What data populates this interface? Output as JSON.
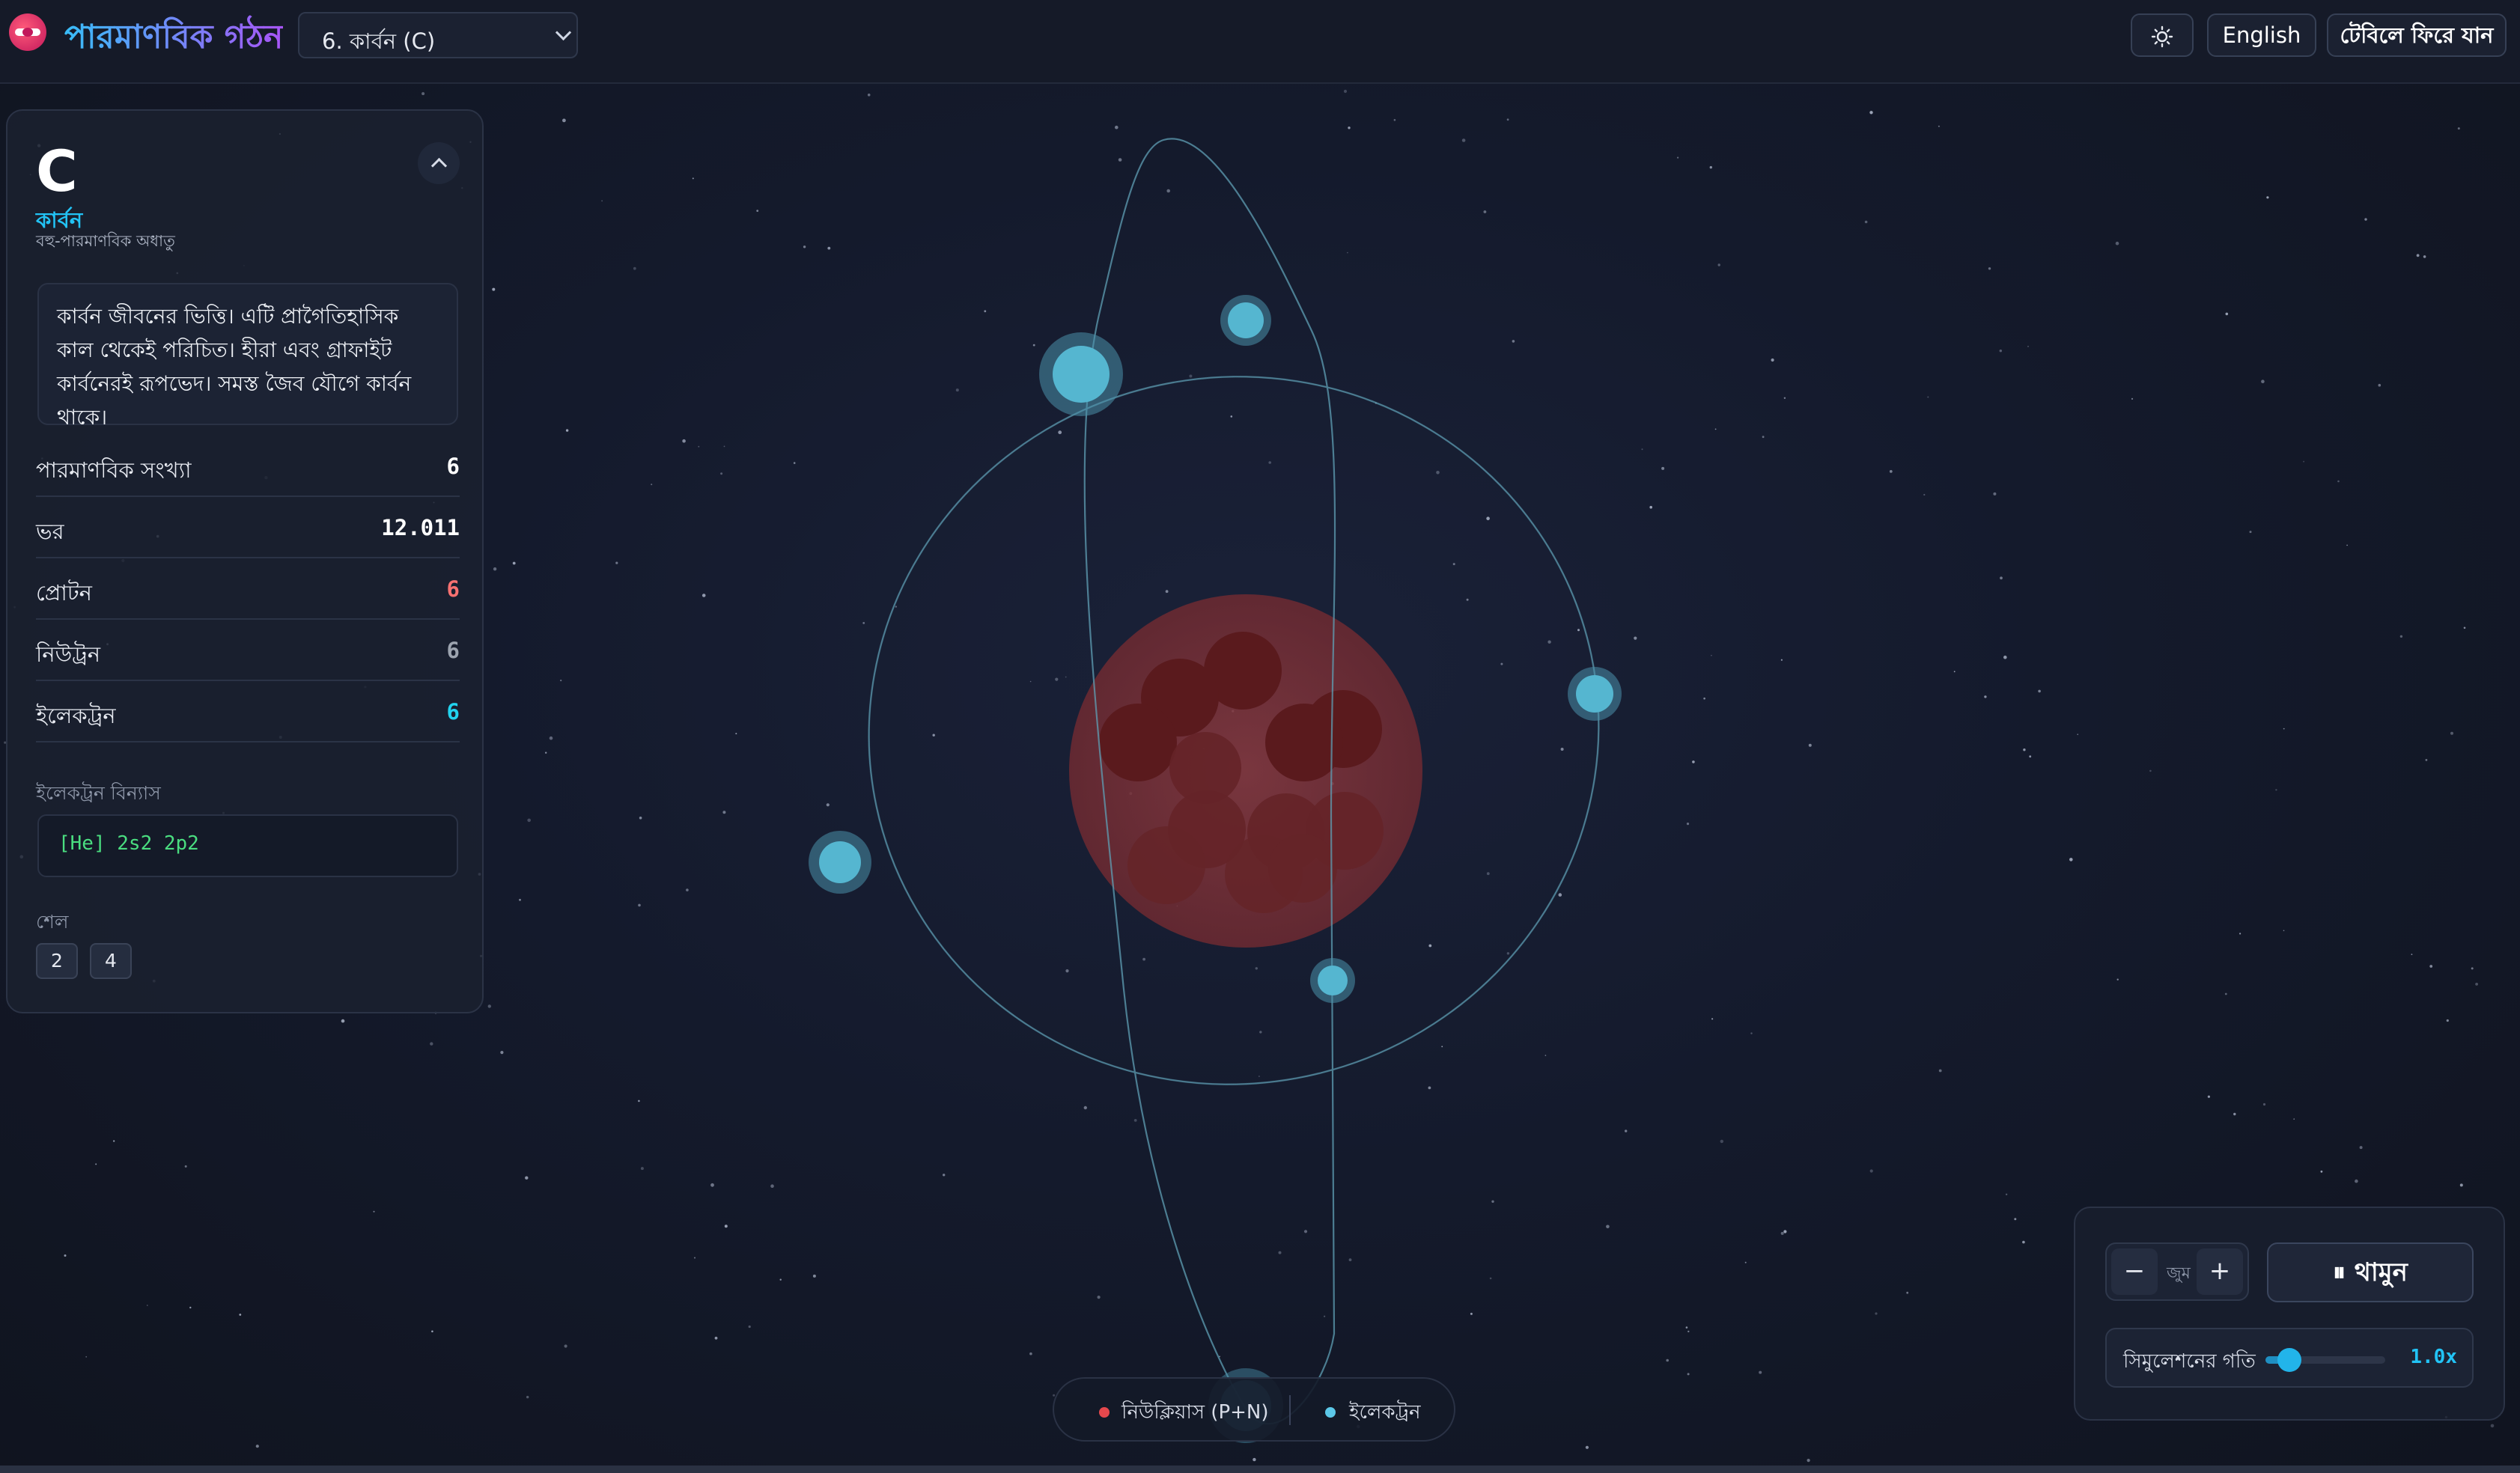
{
  "header": {
    "app_title": "পারমাণবিক গঠন",
    "element_select": "6. কার্বন (C)",
    "theme_icon": "sun-icon",
    "language_button": "English",
    "back_button": "টেবিলে ফিরে যান"
  },
  "panel": {
    "symbol": "C",
    "name": "কার্বন",
    "category": "বহু-পারমাণবিক অধাতু",
    "description": "কার্বন জীবনের ভিত্তি। এটি প্রাগৈতিহাসিক কাল থেকেই পরিচিত। হীরা এবং গ্রাফাইট কার্বনেরই রূপভেদ। সমস্ত জৈব যৌগে কার্বন থাকে।",
    "properties": [
      {
        "label": "পারমাণবিক সংখ্যা",
        "value": "6",
        "color": "#ffffff"
      },
      {
        "label": "ভর",
        "value": "12.011",
        "color": "#ffffff"
      },
      {
        "label": "প্রোটন",
        "value": "6",
        "color": "#f87171"
      },
      {
        "label": "নিউট্রন",
        "value": "6",
        "color": "#9ca3af"
      },
      {
        "label": "ইলেকট্রন",
        "value": "6",
        "color": "#22d3ee"
      }
    ],
    "config_label": "ইলেকট্রন বিন্যাস",
    "config": "[He] 2s2 2p2",
    "shells_label": "শেল",
    "shells": [
      "2",
      "4"
    ]
  },
  "legend": {
    "nucleus": "নিউক্লিয়াস (P+N)",
    "electron": "ইলেকট্রন",
    "nucleus_color": "#e5484d",
    "electron_color": "#5cc8e8"
  },
  "controls": {
    "zoom_label": "জুম",
    "zoom_out": "−",
    "zoom_in": "+",
    "pause_button": "⏸ থামুন",
    "speed_label": "সিমুলেশনের গতি",
    "speed_value": "1.0x",
    "speed_fraction": 0.2
  }
}
